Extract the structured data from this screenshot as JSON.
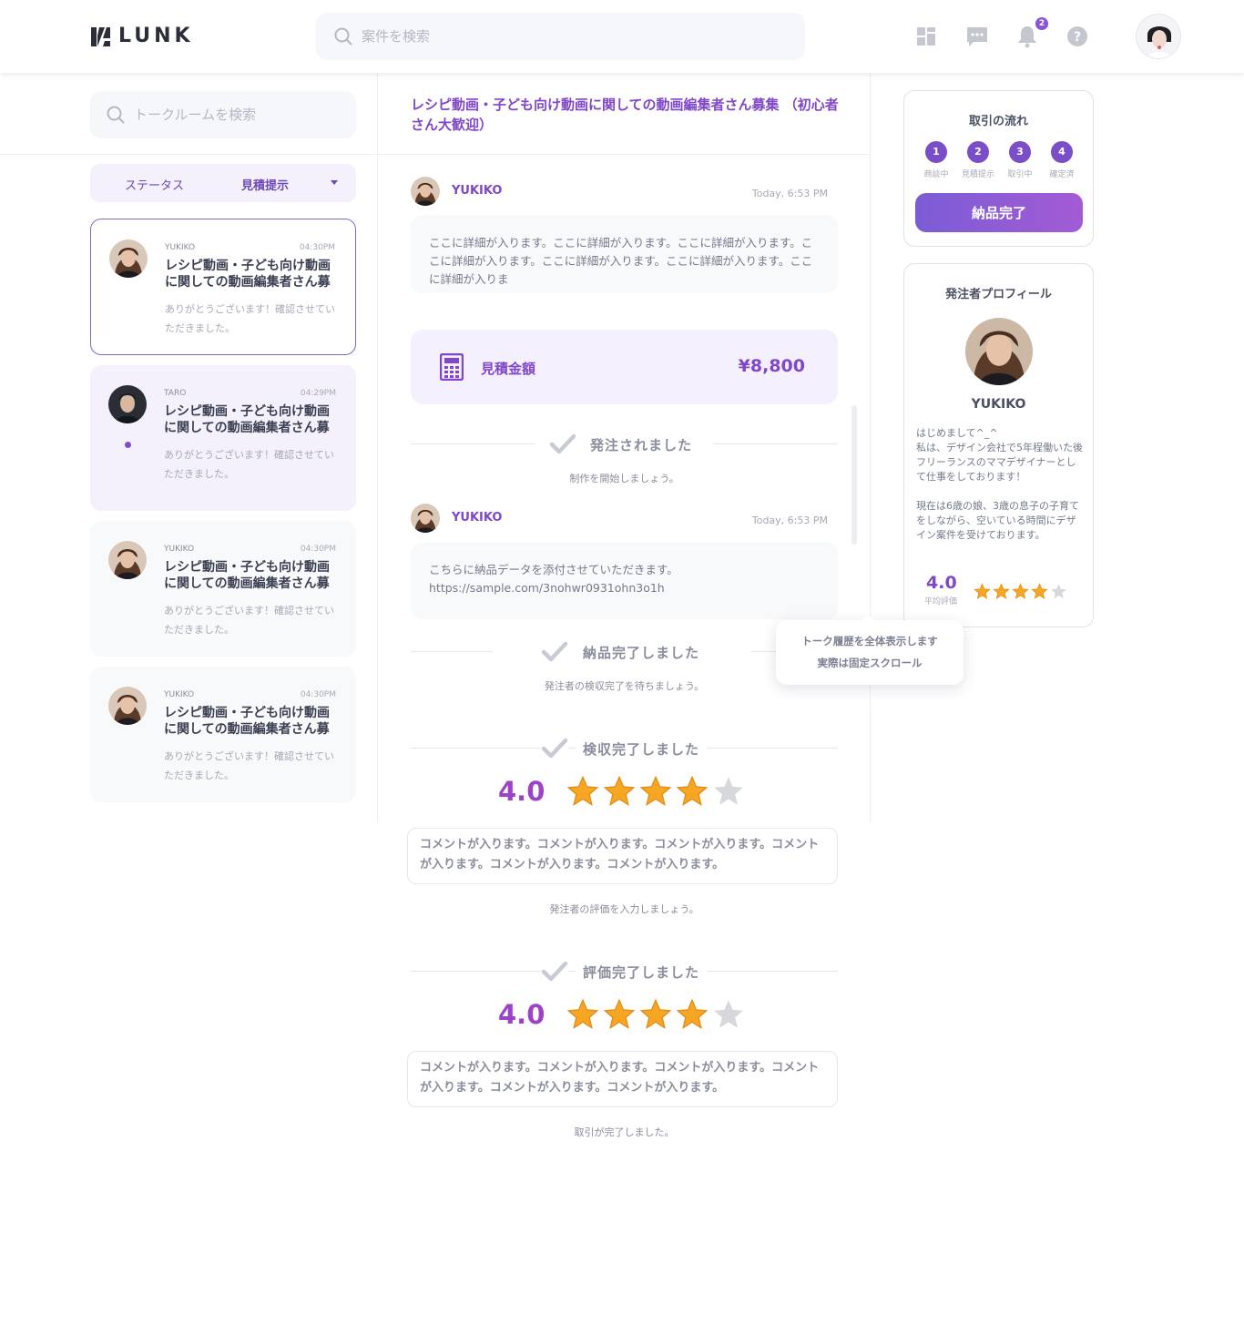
{
  "header": {
    "logo_text": "LUNK",
    "search_placeholder": "案件を検索",
    "notification_count": "2"
  },
  "sidebar": {
    "search_placeholder": "トークルームを検索",
    "status_label": "ステータス",
    "status_value": "見積提示",
    "rooms": [
      {
        "name": "YUKIKO",
        "time": "04:30PM",
        "title": "レシピ動画・子ども向け動画に関しての動画編集者さん募",
        "preview": "ありがとうございます！確認させていただきました。",
        "state": "active"
      },
      {
        "name": "TARO",
        "time": "04:29PM",
        "title": "レシピ動画・子ども向け動画に関しての動画編集者さん募",
        "preview": "ありがとうございます！確認させていただきました。",
        "state": "unread"
      },
      {
        "name": "YUKIKO",
        "time": "04:30PM",
        "title": "レシピ動画・子ども向け動画に関しての動画編集者さん募",
        "preview": "ありがとうございます！確認させていただきました。",
        "state": "normal"
      },
      {
        "name": "YUKIKO",
        "time": "04:30PM",
        "title": "レシピ動画・子ども向け動画に関しての動画編集者さん募",
        "preview": "ありがとうございます！確認させていただきました。",
        "state": "normal"
      }
    ]
  },
  "chat": {
    "title": "レシピ動画・子ども向け動画に関しての動画編集者さん募集 （初心者さん大歓迎）",
    "messages": [
      {
        "name": "YUKIKO",
        "time": "Today, 6:53 PM",
        "text": "ここに詳細が入ります。ここに詳細が入ります。ここに詳細が入ります。ここに詳細が入ります。ここに詳細が入ります。ここに詳細が入ります。ここに詳細が入りま"
      },
      {
        "name": "YUKIKO",
        "time": "Today, 6:53 PM",
        "text": "こちらに納品データを添付させていただきます。\nhttps://sample.com/3nohwr0931ohn3o1h"
      }
    ],
    "quote": {
      "label": "見積金額",
      "amount": "¥8,800"
    },
    "events": [
      {
        "title": "発注されました",
        "sub": "制作を開始しましょう。"
      },
      {
        "title": "納品完了しました",
        "sub": "発注者の検収完了を待ちましょう。"
      },
      {
        "title": "検収完了しました",
        "rating": "4.0",
        "stars": 4,
        "comment": "コメントが入ります。コメントが入ります。コメントが入ります。コメントが入ります。コメントが入ります。コメントが入ります。",
        "sub": "発注者の評価を入力しましょう。"
      },
      {
        "title": "評価完了しました",
        "rating": "4.0",
        "stars": 4,
        "comment": "コメントが入ります。コメントが入ります。コメントが入ります。コメントが入ります。コメントが入ります。コメントが入ります。",
        "sub": "取引が完了しました。"
      }
    ]
  },
  "tooltip": {
    "line1": "トーク履歴を全体表示します",
    "line2": "実際は固定スクロール"
  },
  "flow": {
    "title": "取引の流れ",
    "steps": [
      {
        "num": "1",
        "label": "商談中"
      },
      {
        "num": "2",
        "label": "見積提示"
      },
      {
        "num": "3",
        "label": "取引中"
      },
      {
        "num": "4",
        "label": "確定済"
      }
    ],
    "button_label": "納品完了"
  },
  "profile": {
    "title": "発注者プロフィール",
    "name": "YUKIKO",
    "bio": "はじめまして^_^\n私は、デザイン会社で5年程働いた後フリーランスのママデザイナーとして仕事をしております！\n\n現在は6歳の娘、3歳の息子の子育てをしながら、空いている時間にデザイン案件を受けております。",
    "rating": "4.0",
    "rating_label": "平均評価",
    "stars": 4
  },
  "colors": {
    "accent": "#8047c8",
    "star": "#f5a623",
    "star_empty": "#d6d8de"
  }
}
